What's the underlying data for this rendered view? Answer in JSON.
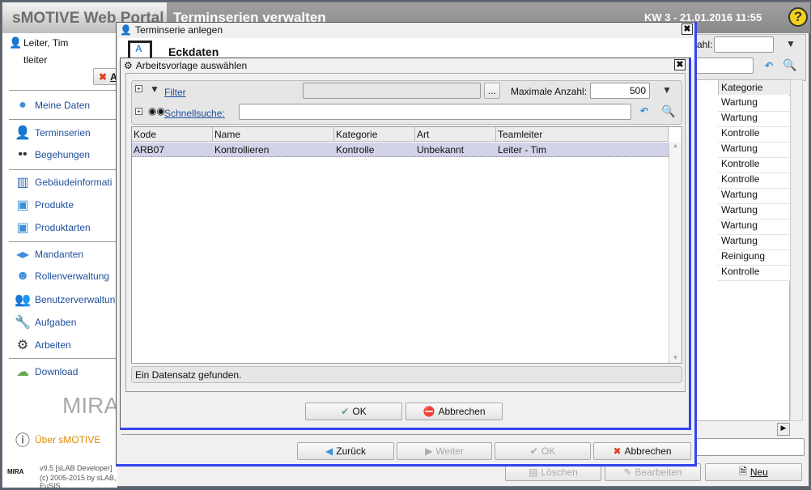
{
  "app": {
    "title": "sMOTIVE Web Portal",
    "page_title": "Terminserien verwalten",
    "datetime": "KW 3 - 21.01.2016 11:55",
    "help_label": "?"
  },
  "user": {
    "name": "Leiter, Tim",
    "login": "tleiter",
    "logout_partial": "A"
  },
  "sidebar": {
    "items": [
      {
        "label": "Meine Daten",
        "icon": "user-icon"
      },
      {
        "label": "Terminserien",
        "icon": "recurring-user-icon"
      },
      {
        "label": "Begehungen",
        "icon": "footprints-icon"
      },
      {
        "label": "Gebäudeinformati",
        "icon": "building-icon"
      },
      {
        "label": "Produkte",
        "icon": "product-icon"
      },
      {
        "label": "Produktarten",
        "icon": "product-type-icon"
      },
      {
        "label": "Mandanten",
        "icon": "tenants-icon"
      },
      {
        "label": "Rollenverwaltung",
        "icon": "masks-icon"
      },
      {
        "label": "Benutzerverwaltun",
        "icon": "users-icon"
      },
      {
        "label": "Aufgaben",
        "icon": "wrench-icon"
      },
      {
        "label": "Arbeiten",
        "icon": "gear-icon"
      },
      {
        "label": "Download",
        "icon": "download-icon"
      }
    ],
    "logo": "MIRA",
    "about": "Über sMOTIVE",
    "version": "v9.5 [sLAB Developer]",
    "copyright": "(c) 2005-2015 by sLAB, EuSIS"
  },
  "background": {
    "max_label_partial": "ahl:",
    "category_header": "Kategorie",
    "categories": [
      "Wartung",
      "Wartung",
      "Kontrolle",
      "Wartung",
      "Kontrolle",
      "Kontrolle",
      "Wartung",
      "Wartung",
      "Wartung",
      "Wartung",
      "Reinigung",
      "Kontrolle"
    ],
    "buttons": {
      "delete": "Löschen",
      "edit": "Bearbeiten",
      "new": "Neu"
    }
  },
  "dialog_outer": {
    "title": "Terminserie anlegen",
    "section": "Eckdaten",
    "buttons": {
      "back": "Zurück",
      "next": "Weiter",
      "ok": "OK",
      "cancel": "Abbrechen"
    }
  },
  "dialog_inner": {
    "title": "Arbeitsvorlage auswählen",
    "filter_label": "Filter",
    "filter_value": "",
    "filter_more": "...",
    "max_label": "Maximale Anzahl:",
    "max_value": "500",
    "quicksearch_label": "Schnellsuche:",
    "quicksearch_value": "",
    "columns": [
      "Kode",
      "Name",
      "Kategorie",
      "Art",
      "Teamleiter"
    ],
    "rows": [
      {
        "kode": "ARB07",
        "name": "Kontrollieren",
        "kategorie": "Kontrolle",
        "art": "Unbekannt",
        "teamleiter": "Leiter - Tim"
      }
    ],
    "status": "Ein Datensatz gefunden.",
    "buttons": {
      "ok": "OK",
      "cancel": "Abbrechen"
    }
  },
  "colors": {
    "link": "#1d4e9c",
    "selected_row": "#d2d2e8",
    "about": "#e08a00",
    "header": "#8a8a8a"
  }
}
